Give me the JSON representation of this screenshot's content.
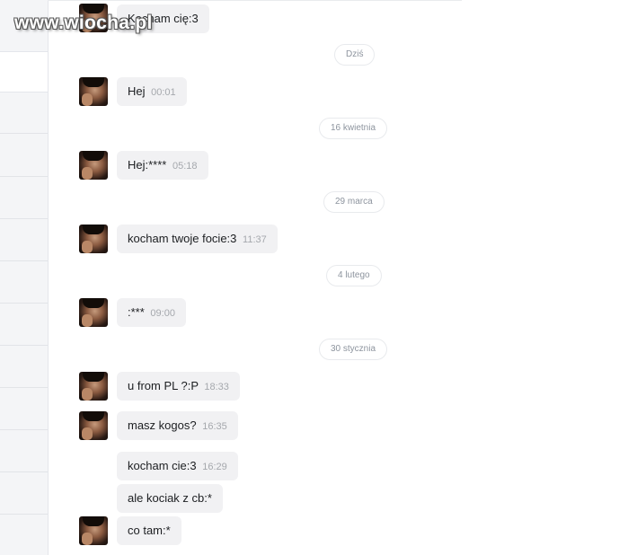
{
  "watermark": "www.wiocha.pl",
  "messages": [
    {
      "text": "Kocham cię:3",
      "time": ""
    },
    {
      "text": "Hej",
      "time": "00:01"
    },
    {
      "text": "Hej:****",
      "time": "05:18"
    },
    {
      "text": "kocham twoje focie:3",
      "time": "11:37"
    },
    {
      "text": ":***",
      "time": "09:00"
    },
    {
      "text": "u from PL ?:P",
      "time": "18:33"
    },
    {
      "text": "masz kogos?",
      "time": "16:35"
    },
    {
      "text": "kocham cie:3",
      "time": "16:29"
    },
    {
      "text": "ale kociak z cb:*",
      "time": ""
    },
    {
      "text": "co tam:*",
      "time": ""
    }
  ],
  "dates": [
    "Dziś",
    "16 kwietnia",
    "29 marca",
    "4 lutego",
    "30 stycznia"
  ]
}
